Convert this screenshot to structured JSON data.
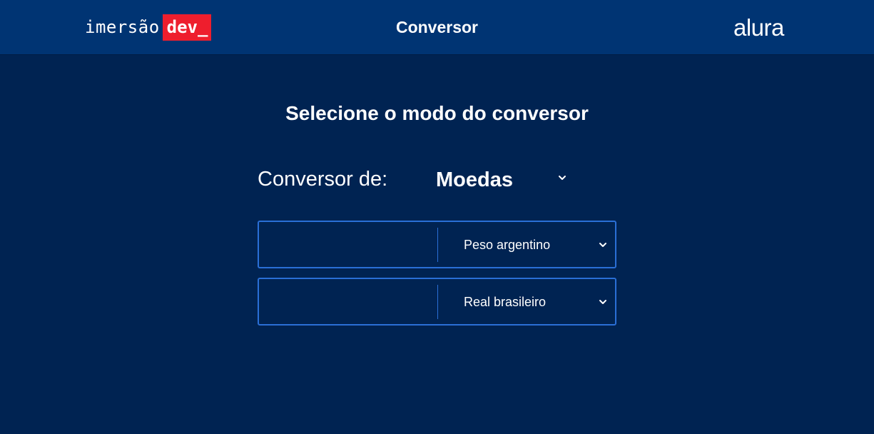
{
  "header": {
    "brand_light": "imersão",
    "brand_highlight": "dev_",
    "title": "Conversor",
    "partner_logo": "alura",
    "colors": {
      "bar": "#003473",
      "brand_highlight_bg": "#ee1e2d"
    }
  },
  "main": {
    "title": "Selecione o modo do conversor",
    "mode": {
      "label": "Conversor de:",
      "selected": "Moedas",
      "icon": "chevron-down-icon"
    },
    "converters": [
      {
        "amount_value": "",
        "currency": "Peso argentino",
        "icon": "chevron-down-icon"
      },
      {
        "amount_value": "",
        "currency": "Real brasileiro",
        "icon": "chevron-down-icon"
      }
    ],
    "colors": {
      "background": "#002352",
      "input_border": "#2a6fd6"
    }
  }
}
